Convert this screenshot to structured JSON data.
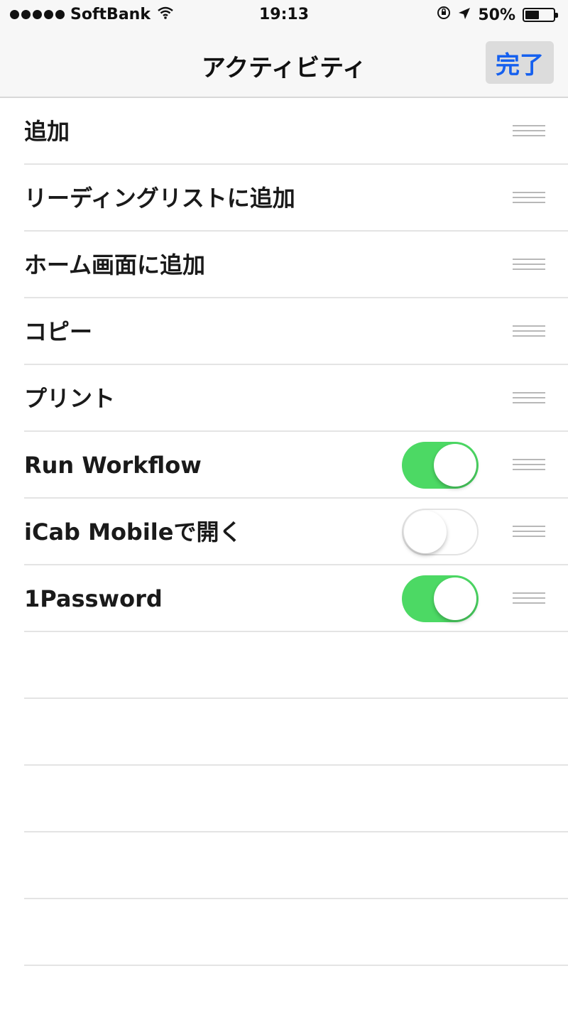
{
  "status_bar": {
    "carrier": "SoftBank",
    "time": "19:13",
    "battery_percent": "50%",
    "battery_level": 0.5
  },
  "nav": {
    "title": "アクティビティ",
    "done_label": "完了"
  },
  "activities": [
    {
      "label": "追加",
      "has_toggle": false
    },
    {
      "label": "リーディングリストに追加",
      "has_toggle": false
    },
    {
      "label": "ホーム画面に追加",
      "has_toggle": false
    },
    {
      "label": "コピー",
      "has_toggle": false
    },
    {
      "label": "プリント",
      "has_toggle": false
    },
    {
      "label": "Run Workflow",
      "has_toggle": true,
      "enabled": true
    },
    {
      "label": "iCab Mobileで開く",
      "has_toggle": true,
      "enabled": false
    },
    {
      "label": "1Password",
      "has_toggle": true,
      "enabled": true
    }
  ],
  "colors": {
    "accent": "#1560ef",
    "toggle_on": "#4cd964"
  }
}
